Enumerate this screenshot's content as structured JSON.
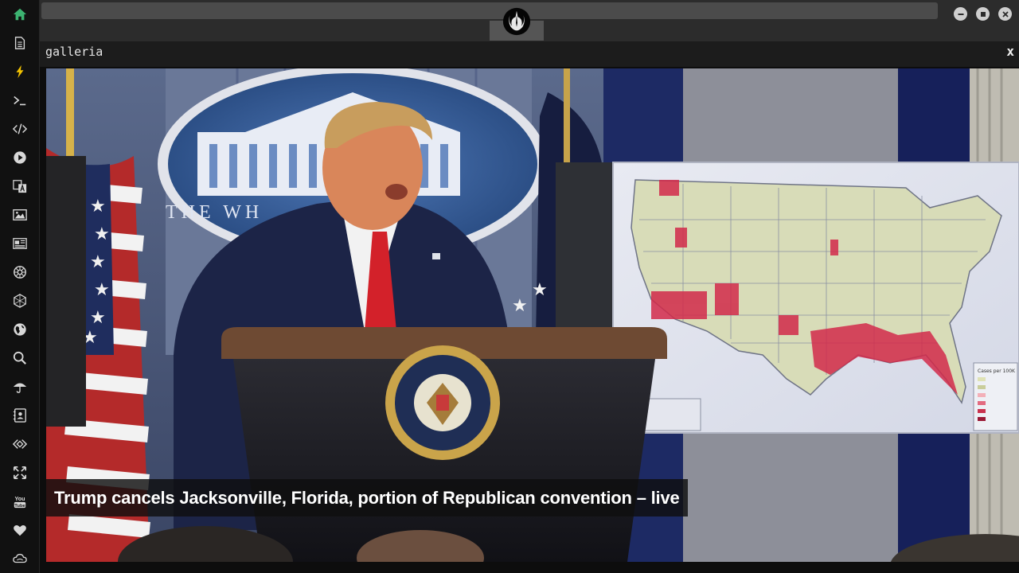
{
  "sidebar": {
    "items": [
      {
        "name": "home",
        "icon": "home-icon",
        "color": "#3cb371"
      },
      {
        "name": "document",
        "icon": "document-icon",
        "color": "#d8d8d8"
      },
      {
        "name": "flash",
        "icon": "lightning-icon",
        "color": "#f2c200"
      },
      {
        "name": "terminal",
        "icon": "terminal-icon",
        "color": "#d8d8d8"
      },
      {
        "name": "code",
        "icon": "code-icon",
        "color": "#d8d8d8"
      },
      {
        "name": "play",
        "icon": "play-icon",
        "color": "#d8d8d8"
      },
      {
        "name": "translate",
        "icon": "translate-icon",
        "color": "#d8d8d8"
      },
      {
        "name": "image",
        "icon": "image-icon",
        "color": "#d8d8d8"
      },
      {
        "name": "news",
        "icon": "newspaper-icon",
        "color": "#d8d8d8"
      },
      {
        "name": "empire",
        "icon": "empire-icon",
        "color": "#d8d8d8"
      },
      {
        "name": "hexagon",
        "icon": "hexagon-icon",
        "color": "#d8d8d8"
      },
      {
        "name": "globe",
        "icon": "globe-icon",
        "color": "#d8d8d8"
      },
      {
        "name": "search",
        "icon": "search-icon",
        "color": "#d8d8d8"
      },
      {
        "name": "umbrella",
        "icon": "umbrella-icon",
        "color": "#d8d8d8"
      },
      {
        "name": "contacts",
        "icon": "contacts-icon",
        "color": "#d8d8d8"
      },
      {
        "name": "api",
        "icon": "api-icon",
        "color": "#d8d8d8"
      },
      {
        "name": "expand",
        "icon": "expand-icon",
        "color": "#d8d8d8"
      },
      {
        "name": "youtube",
        "icon": "youtube-icon",
        "color": "#d8d8d8"
      },
      {
        "name": "heart",
        "icon": "heart-icon",
        "color": "#d8d8d8"
      },
      {
        "name": "cloud",
        "icon": "cloud-icon",
        "color": "#d8d8d8"
      }
    ]
  },
  "titlebar": {
    "logo_icon": "rebel-alliance-icon",
    "window_controls": [
      "minimize-icon",
      "maximize-icon",
      "close-icon"
    ]
  },
  "panel": {
    "title": "galleria",
    "close_label": "x"
  },
  "image": {
    "caption": "Trump cancels Jacksonville, Florida, portion of Republican convention – live",
    "map_caption_line": "Cases per 100K"
  },
  "colors": {
    "background": "#0d0d0d",
    "sidebar": "#111111",
    "topbar": "#2c2c2c",
    "panel_header": "#1c1c1c",
    "accent_home": "#3cb371",
    "accent_flash": "#f2c200"
  }
}
